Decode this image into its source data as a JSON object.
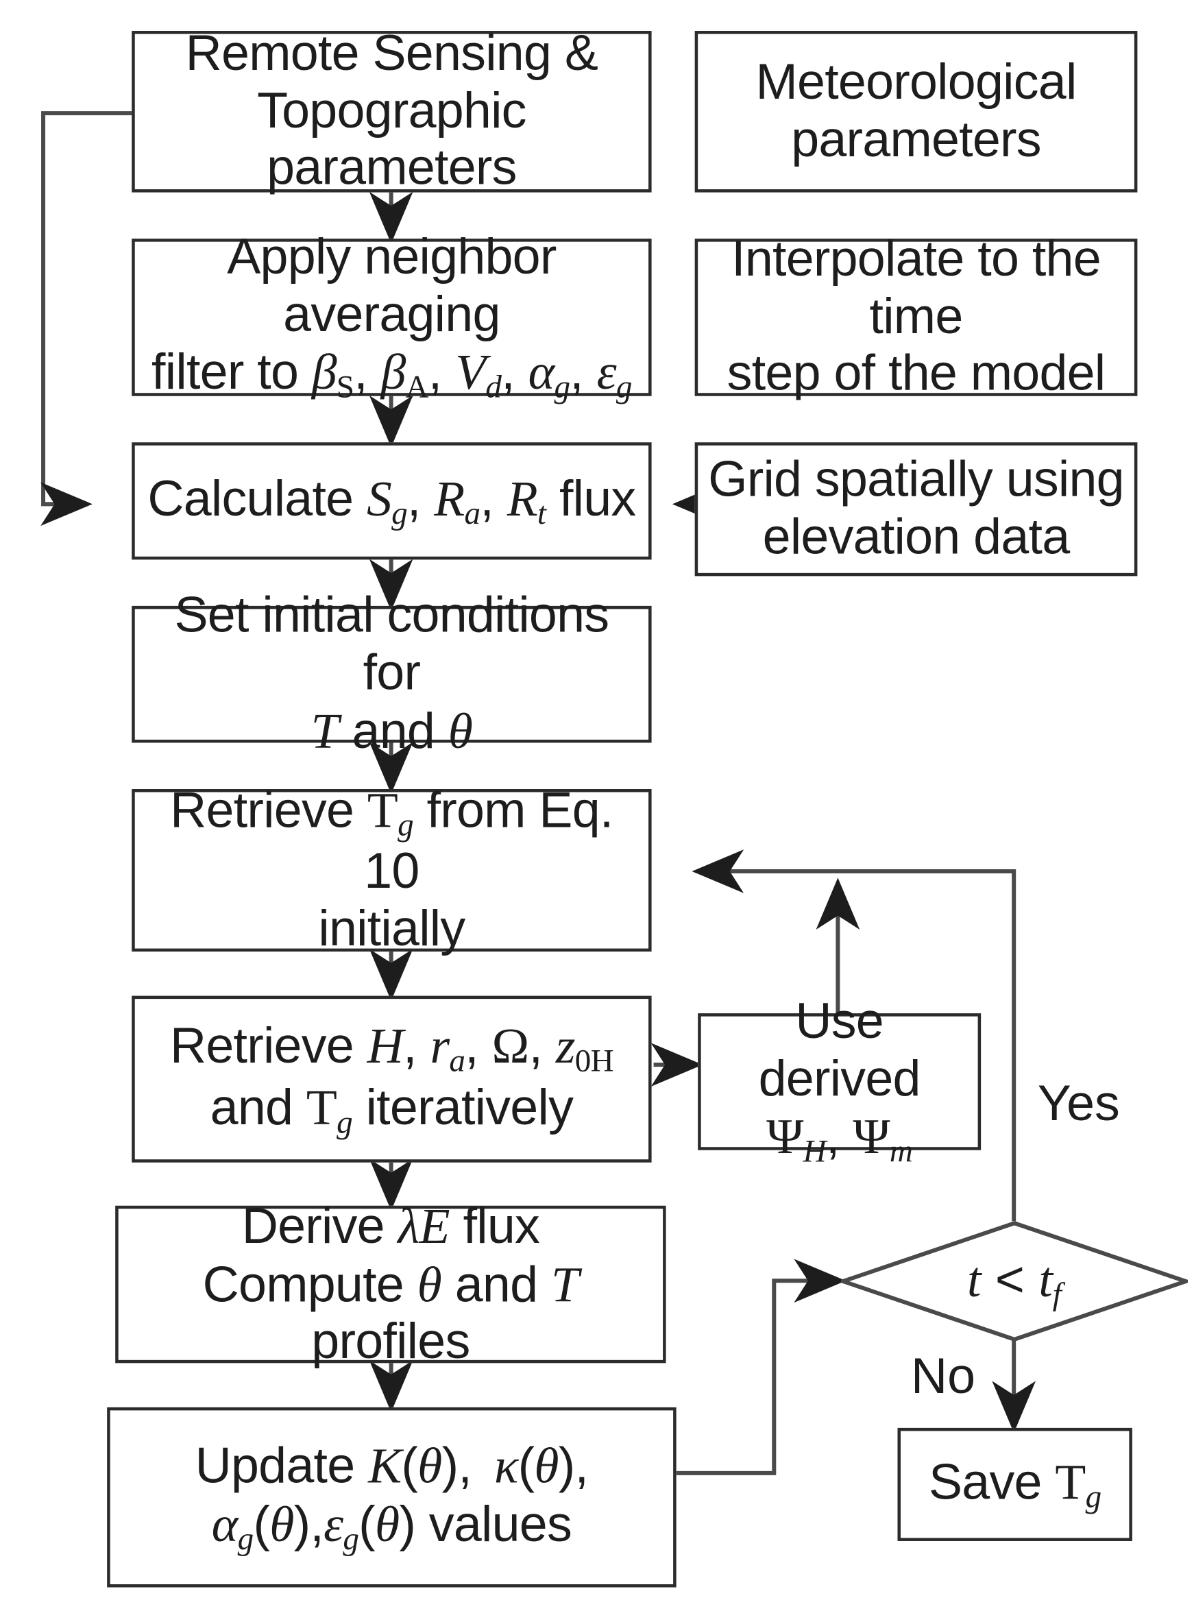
{
  "diagram": {
    "title": "Land surface energy balance model flowchart",
    "background": "#ffffff",
    "line_color": "#2b2b2b"
  },
  "nodes": {
    "remote_sensing": {
      "line1": "Remote Sensing &",
      "line2": "Topographic parameters"
    },
    "meteorological": {
      "line1": "Meteorological",
      "line2": "parameters"
    },
    "neighbor_filter": {
      "line1": "Apply neighbor averaging",
      "line2_prefix": "filter to ",
      "line2_symbols": "βS, βA, Vd, αg, εg"
    },
    "interpolate": {
      "line1": "Interpolate to the time",
      "line2": "step of the model"
    },
    "calculate_flux": {
      "prefix": "Calculate ",
      "symbols": "Sg, Ra, Rt",
      "suffix": " flux"
    },
    "grid_spatially": {
      "line1": "Grid spatially using",
      "line2": "elevation data"
    },
    "set_initial": {
      "line1": "Set initial conditions for",
      "line2": "T and θ"
    },
    "retrieve_tg": {
      "line1": "Retrieve Tg from Eq. 10",
      "line2": "initially"
    },
    "retrieve_h": {
      "line1": "Retrieve H, ra, Ω, z0H",
      "line2": "and Tg iteratively"
    },
    "use_derived": {
      "line1": "Use derived",
      "line2": "ΨH, Ψm"
    },
    "derive_le": {
      "line1": "Derive λE flux",
      "line2": "Compute θ and T profiles"
    },
    "update_k": {
      "line1": "Update K(θ),  κ(θ),",
      "line2": "αg(θ), εg(θ) values"
    },
    "decision": {
      "condition": "t < tf"
    },
    "save_tg": {
      "label": "Save Tg"
    }
  },
  "edge_labels": {
    "yes": "Yes",
    "no": "No"
  }
}
